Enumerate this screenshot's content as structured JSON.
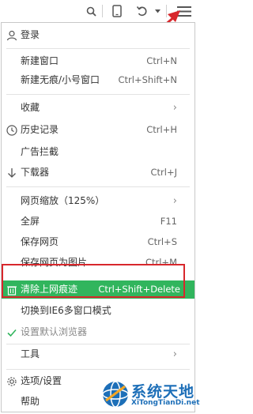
{
  "toolbar": {
    "icons": [
      "search-icon",
      "phone-icon",
      "undo-icon",
      "dropdown-arrow-icon",
      "menu-icon"
    ]
  },
  "menu": {
    "login": "登录",
    "new_window": {
      "label": "新建窗口",
      "shortcut": "Ctrl+N"
    },
    "new_private_window": {
      "label": "新建无痕/小号窗口",
      "shortcut": "Ctrl+Shift+N"
    },
    "favorites": {
      "label": "收藏"
    },
    "history": {
      "label": "历史记录",
      "shortcut": "Ctrl+H"
    },
    "ad_block": {
      "label": "广告拦截"
    },
    "downloader": {
      "label": "下载器",
      "shortcut": "Ctrl+J"
    },
    "zoom": {
      "label": "网页缩放（125%）"
    },
    "fullscreen": {
      "label": "全屏",
      "shortcut": "F11"
    },
    "save_page": {
      "label": "保存网页",
      "shortcut": "Ctrl+S"
    },
    "save_as_image": {
      "label": "保存网页为图片",
      "shortcut": "Ctrl+M"
    },
    "clear_traces": {
      "label": "清除上网痕迹",
      "shortcut": "Ctrl+Shift+Delete"
    },
    "ie6_mode": {
      "label": "切换到IE6多窗口模式"
    },
    "set_default": {
      "label": "设置默认浏览器"
    },
    "tools": {
      "label": "工具"
    },
    "options": {
      "label": "选项/设置"
    },
    "help": {
      "label": "帮助"
    }
  },
  "watermark": {
    "brand": "系统天地",
    "url": "XiTongTianDi.net"
  },
  "colors": {
    "highlight": "#31b55d",
    "annotation_red": "#d8272c",
    "brand_blue": "#1d6fb8"
  }
}
